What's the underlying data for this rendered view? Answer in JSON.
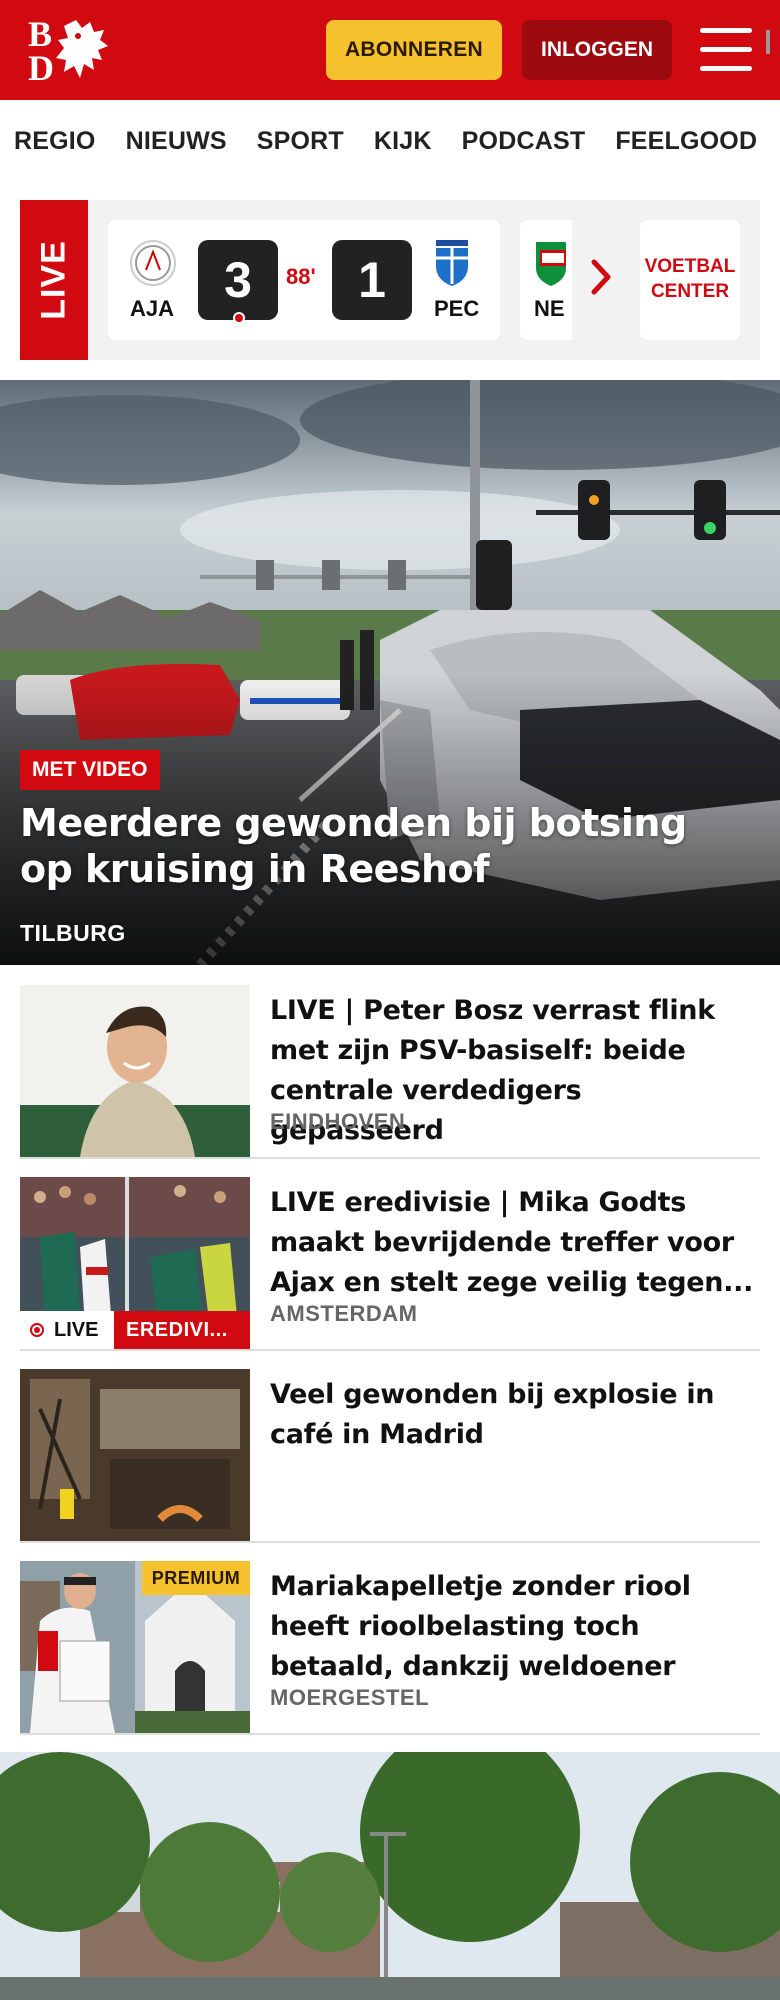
{
  "brand": {
    "logo_b": "B",
    "logo_d": "D",
    "primary_color": "#d10a11",
    "accent_color": "#f5c22e"
  },
  "header": {
    "subscribe_label": "ABONNEREN",
    "login_label": "INLOGGEN"
  },
  "nav": {
    "items": [
      "REGIO",
      "NIEUWS",
      "SPORT",
      "KIJK",
      "PODCAST",
      "FEELGOOD"
    ]
  },
  "live": {
    "tag": "LIVE",
    "match": {
      "home": "AJA",
      "home_score": "3",
      "minute": "88'",
      "away_score": "1",
      "away": "PEC"
    },
    "next_match_team": "NE",
    "voetbal_center": "VOETBAL CENTER"
  },
  "hero": {
    "badge": "MET VIDEO",
    "title": "Meerdere gewonden bij botsing op kruising in Reeshof",
    "location": "TILBURG"
  },
  "articles": [
    {
      "title": "LIVE | Peter Bosz verrast flink met zijn PSV-basiself: beide centrale verdedigers gepasseerd",
      "location": "EINDHOVEN"
    },
    {
      "title": "LIVE eredivisie | Mika Godts maakt bevrijdende treffer voor Ajax en stelt zege veilig tegen...",
      "location": "AMSTERDAM",
      "live_label": "LIVE",
      "category": "EREDIVI..."
    },
    {
      "title": "Veel gewonden bij explosie in café in Madrid",
      "location": ""
    },
    {
      "title": "Mariakapelletje zonder riool heeft rioolbelasting toch betaald, dankzij weldoener",
      "location": "MOERGESTEL",
      "premium": "PREMIUM"
    }
  ]
}
